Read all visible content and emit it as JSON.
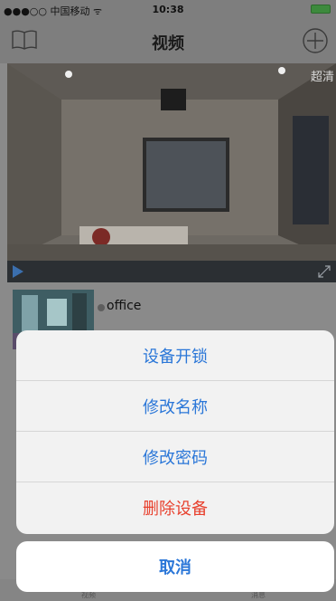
{
  "statusbar": {
    "carrier": "●●●○○ 中国移动 ᯤ",
    "time": "10:38"
  },
  "navbar": {
    "title": "视频"
  },
  "video": {
    "quality": "超清"
  },
  "device": {
    "name": "office"
  },
  "tabbar": {
    "left": "视频",
    "right": "消息"
  },
  "action_sheet": {
    "items": [
      "设备开锁",
      "修改名称",
      "修改密码",
      "删除设备"
    ],
    "cancel": "取消"
  },
  "colors": {
    "accent": "#2b77d8",
    "danger": "#e8412e"
  }
}
